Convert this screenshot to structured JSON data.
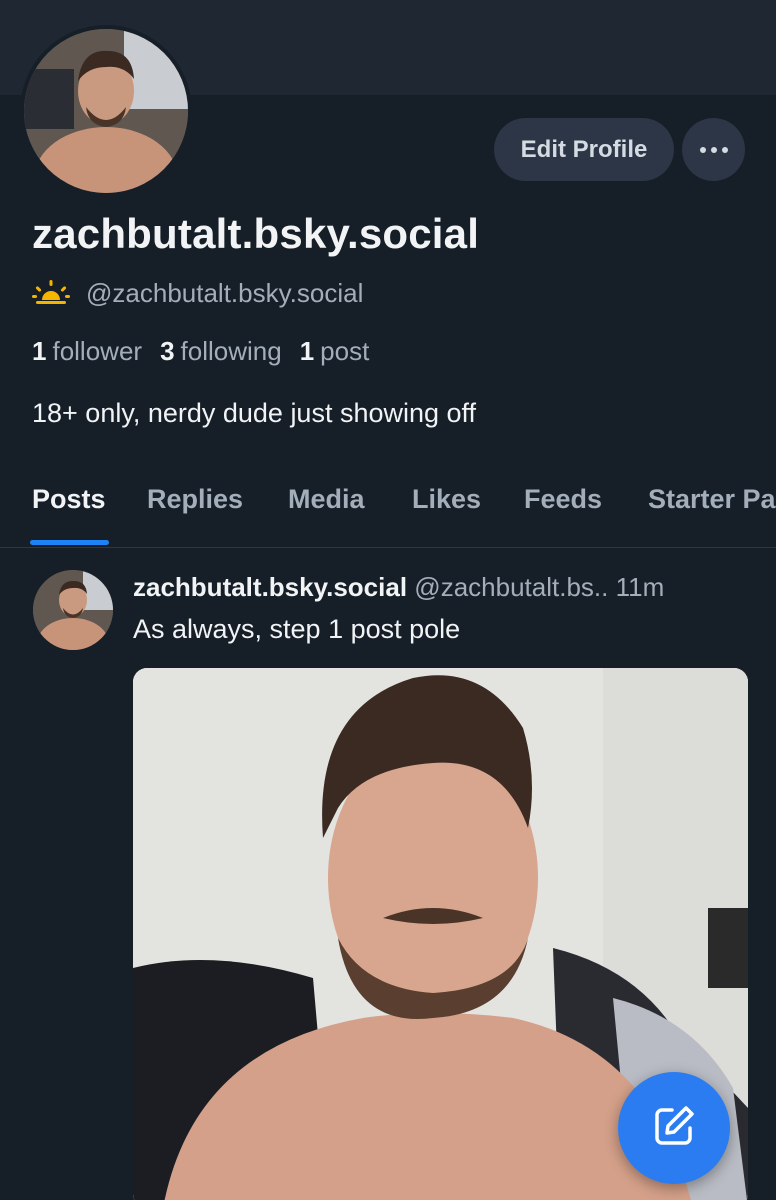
{
  "profile": {
    "display_name": "zachbutalt.bsky.social",
    "handle": "@zachbutalt.bsky.social",
    "bio": "18+ only, nerdy dude just showing off",
    "stats": {
      "followers_count": "1",
      "followers_label": "follower",
      "following_count": "3",
      "following_label": "following",
      "posts_count": "1",
      "posts_label": "post"
    }
  },
  "actions": {
    "edit_profile_label": "Edit Profile",
    "more_icon": "more-horizontal-icon"
  },
  "tabs": [
    {
      "label": "Posts",
      "active": true
    },
    {
      "label": "Replies"
    },
    {
      "label": "Media"
    },
    {
      "label": "Likes"
    },
    {
      "label": "Feeds"
    },
    {
      "label": "Starter Packs"
    }
  ],
  "post": {
    "author": "zachbutalt.bsky.social",
    "handle": "@zachbutalt.bs..",
    "time": "11m",
    "text": "As always, step 1 post pole"
  },
  "compose_icon": "compose-icon",
  "colors": {
    "background": "#161e27",
    "banner": "#1f2733",
    "button_bg": "#2c3646",
    "accent": "#1d82f5",
    "fab": "#2b7cf0",
    "muted_text": "#a3aebb",
    "sun_icon": "#f5b400"
  }
}
